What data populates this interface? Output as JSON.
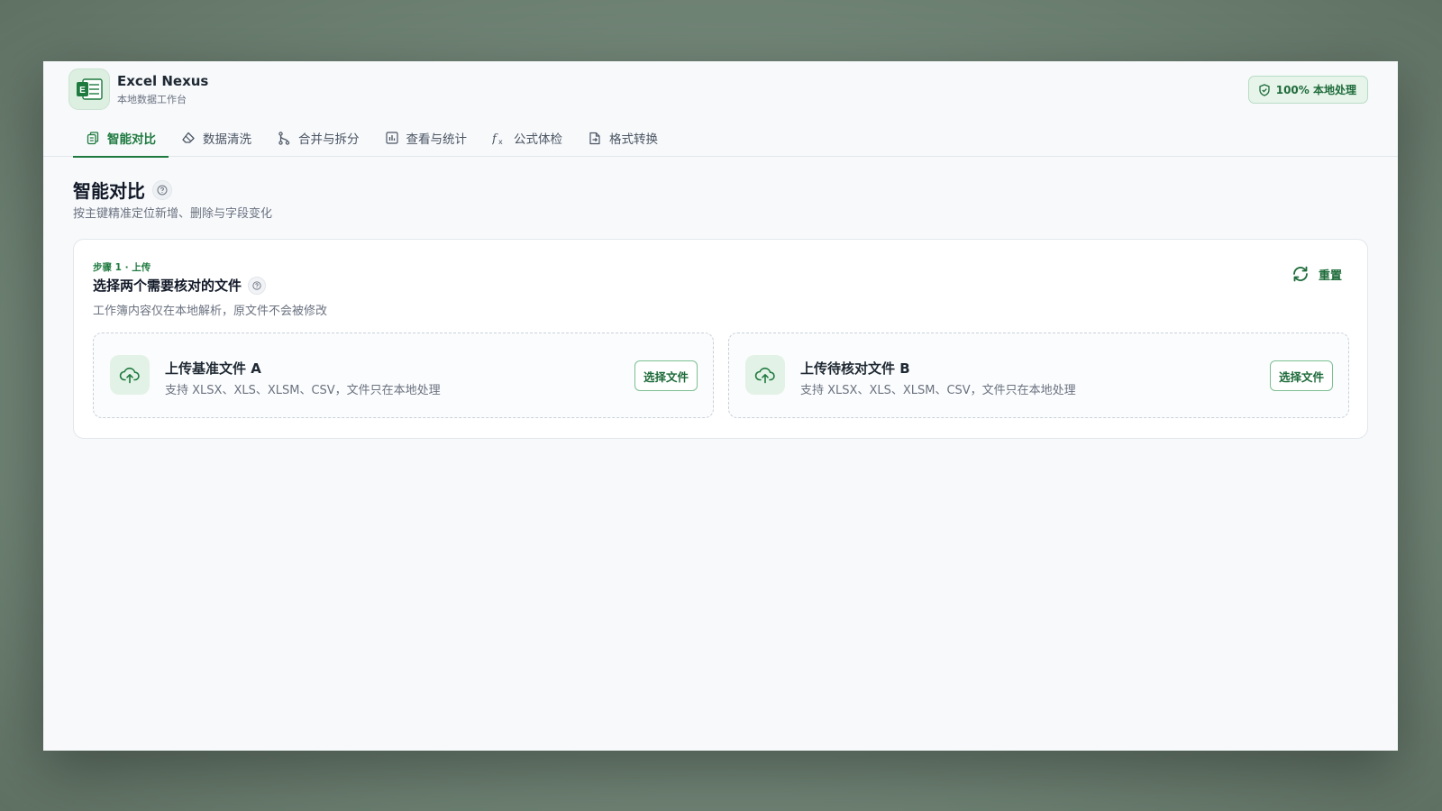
{
  "app": {
    "name": "Excel Nexus",
    "subtitle": "本地数据工作台",
    "local_badge": "100% 本地处理",
    "accent_color": "#1e7a3f"
  },
  "tabs": [
    {
      "label": "智能对比",
      "icon": "copy-icon",
      "active": true
    },
    {
      "label": "数据清洗",
      "icon": "eraser-icon",
      "active": false
    },
    {
      "label": "合并与拆分",
      "icon": "merge-icon",
      "active": false
    },
    {
      "label": "查看与统计",
      "icon": "bar-chart-icon",
      "active": false
    },
    {
      "label": "公式体检",
      "icon": "function-icon",
      "active": false
    },
    {
      "label": "格式转换",
      "icon": "file-convert-icon",
      "active": false
    }
  ],
  "page": {
    "title": "智能对比",
    "subtitle": "按主键精准定位新增、删除与字段变化"
  },
  "card": {
    "step_label": "步骤 1 · 上传",
    "title": "选择两个需要核对的文件",
    "description": "工作簿内容仅在本地解析，原文件不会被修改",
    "reset_label": "重置"
  },
  "uploads": [
    {
      "title": "上传基准文件 A",
      "description": "支持 XLSX、XLS、XLSM、CSV，文件只在本地处理",
      "button": "选择文件"
    },
    {
      "title": "上传待核对文件 B",
      "description": "支持 XLSX、XLS、XLSM、CSV，文件只在本地处理",
      "button": "选择文件"
    }
  ]
}
